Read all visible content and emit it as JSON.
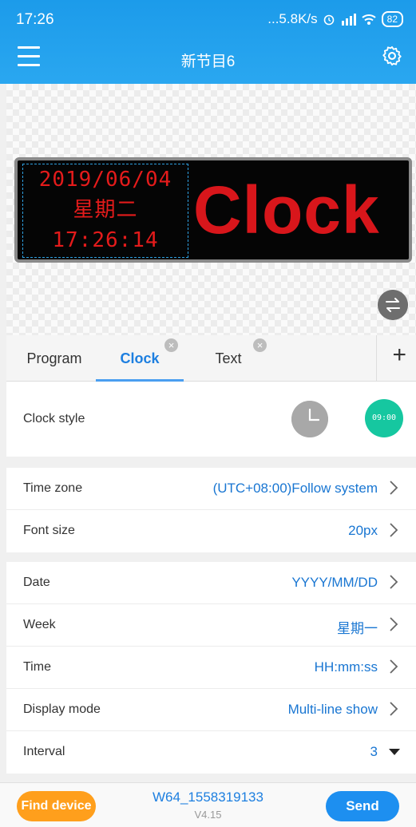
{
  "status_bar": {
    "time": "17:26",
    "network_speed": "...5.8K/s",
    "battery": "82"
  },
  "app_bar": {
    "title": "新节目6"
  },
  "preview": {
    "clock_lines": [
      "2019/06/04",
      "星期二",
      "17:26:14"
    ],
    "text_content": "Clock"
  },
  "tabs": [
    {
      "label": "Program"
    },
    {
      "label": "Clock"
    },
    {
      "label": "Text"
    }
  ],
  "clock_style": {
    "label": "Clock style",
    "digital_preview": "09:00"
  },
  "settings_group1": [
    {
      "label": "Time zone",
      "value": "(UTC+08:00)Follow system"
    },
    {
      "label": "Font size",
      "value": "20px"
    }
  ],
  "settings_group2": [
    {
      "label": "Date",
      "value": "YYYY/MM/DD"
    },
    {
      "label": "Week",
      "value": "星期一"
    },
    {
      "label": "Time",
      "value": "HH:mm:ss"
    },
    {
      "label": "Display mode",
      "value": "Multi-line show"
    },
    {
      "label": "Interval",
      "value": "3"
    }
  ],
  "bottom_bar": {
    "find_device_label": "Find device",
    "device_name": "W64_1558319133",
    "version": "V4.15",
    "send_label": "Send"
  },
  "colors": {
    "primary": "#1d8ff0",
    "accent_orange": "#ff9f1c",
    "led_red": "#e41b1b",
    "digital_green": "#16c7a0"
  }
}
